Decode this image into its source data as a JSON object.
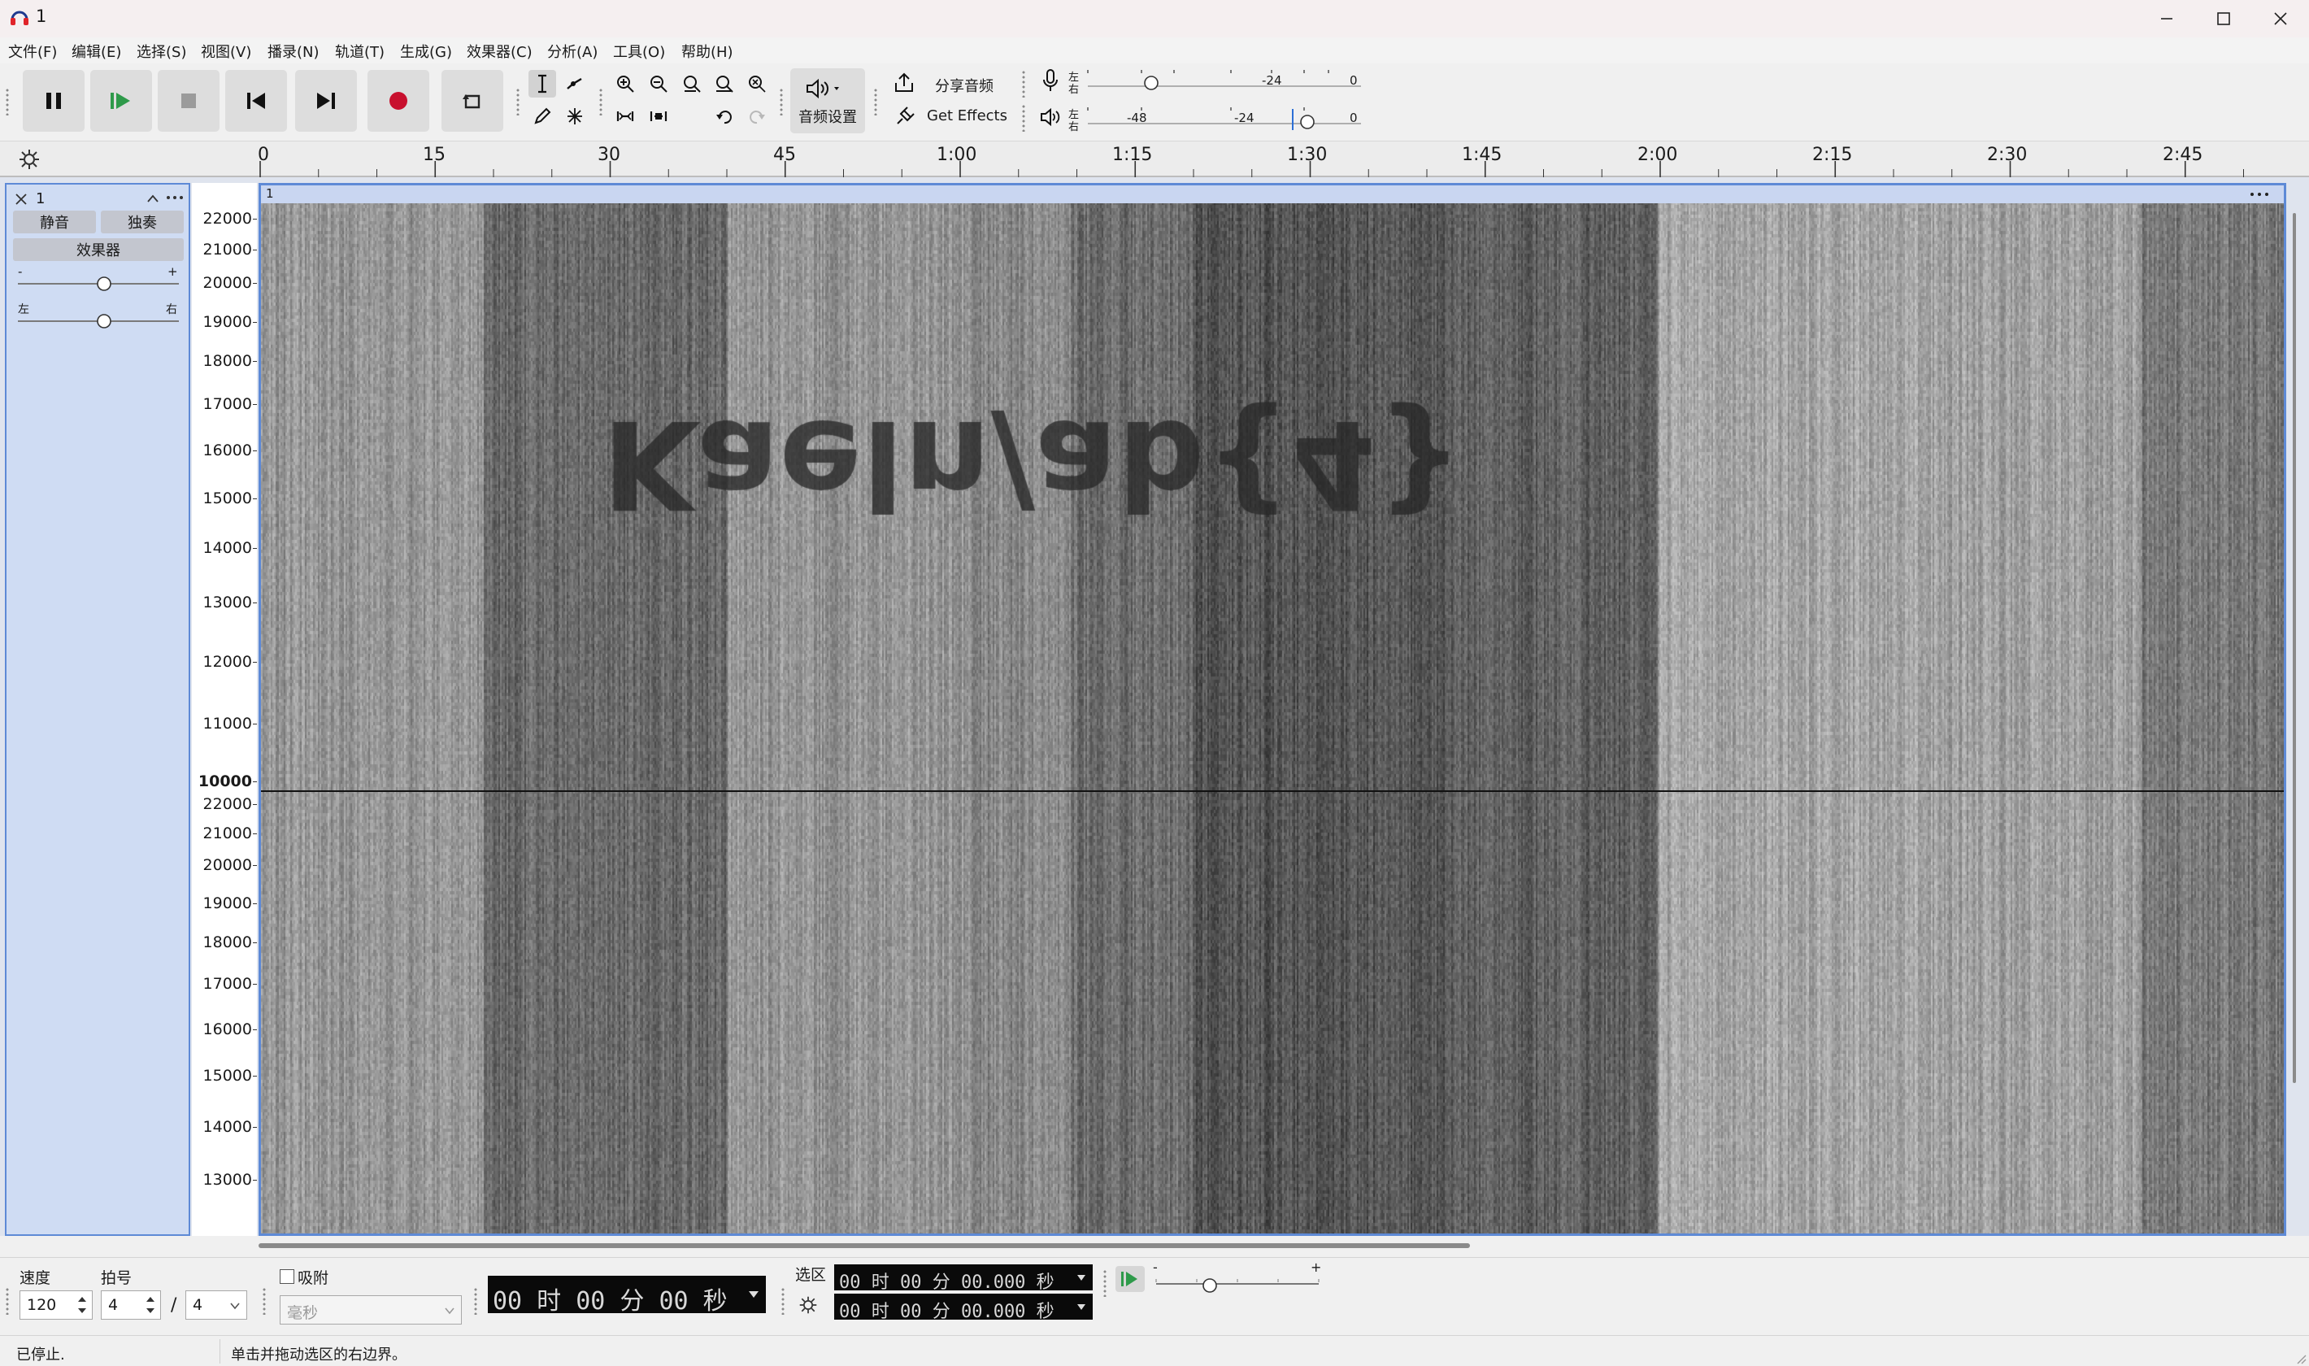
{
  "window": {
    "title": "1",
    "minimize_icon": "minimize-icon",
    "maximize_icon": "maximize-icon",
    "close_icon": "close-icon"
  },
  "menu": [
    "文件(F)",
    "编辑(E)",
    "选择(S)",
    "视图(V)",
    "播录(N)",
    "轨道(T)",
    "生成(G)",
    "效果器(C)",
    "分析(A)",
    "工具(O)",
    "帮助(H)"
  ],
  "toolbar": {
    "audio_setup_label": "音频设置",
    "share_audio_label": "分享音频",
    "get_effects_label": "Get Effects",
    "meter_record": {
      "ticks": [
        "-24",
        "0"
      ],
      "lr": [
        "左",
        "右"
      ]
    },
    "meter_play": {
      "ticks": [
        "-48",
        "-24",
        "0"
      ],
      "lr": [
        "左",
        "右"
      ]
    }
  },
  "ruler": {
    "labels": [
      "0",
      "15",
      "30",
      "45",
      "1:00",
      "1:15",
      "1:30",
      "1:45",
      "2:00",
      "2:15",
      "2:30",
      "2:45"
    ]
  },
  "track": {
    "name": "1",
    "mute_label": "静音",
    "solo_label": "独奏",
    "effects_label": "效果器",
    "gain_minus": "-",
    "gain_plus": "+",
    "pan_left": "左",
    "pan_right": "右",
    "clip_name": "1",
    "freq_top": [
      "22000",
      "21000",
      "20000",
      "19000",
      "18000",
      "17000",
      "16000",
      "15000",
      "14000",
      "13000",
      "12000",
      "11000",
      "10000"
    ],
    "freq_bottom": [
      "22000",
      "21000",
      "20000",
      "19000",
      "18000",
      "17000",
      "16000",
      "15000",
      "14000",
      "13000"
    ],
    "hidden_message": "Kaeln/ab{4}"
  },
  "bottom": {
    "tempo_label": "速度",
    "tempo_value": "120",
    "timesig_label": "拍号",
    "timesig_num": "4",
    "timesig_sep": "/",
    "timesig_den": "4",
    "snap_label": "吸附",
    "snap_unit": "毫秒",
    "time_display": "00 时 00 分 00 秒",
    "selection_label": "选区",
    "sel_start": "00 时 00 分 00.000 秒",
    "sel_end": "00 时 00 分 00.000 秒",
    "speed_minus": "-",
    "speed_plus": "+"
  },
  "status": {
    "state": "已停止.",
    "hint": "单击并拖动选区的右边界。"
  },
  "colors": {
    "accent": "#5e8ad6",
    "record": "#c8102e",
    "play": "#2e9a4a"
  }
}
